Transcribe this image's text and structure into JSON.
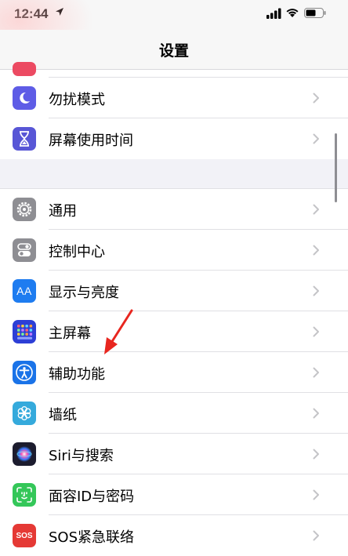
{
  "status_bar": {
    "time": "12:44"
  },
  "nav": {
    "title": "设置"
  },
  "group1": [
    {
      "label": "勿扰模式",
      "icon": "moon-icon",
      "color": "#5e5ce6"
    },
    {
      "label": "屏幕使用时间",
      "icon": "hourglass-icon",
      "color": "#5856d6"
    }
  ],
  "group2": [
    {
      "label": "通用",
      "icon": "gear-icon",
      "color": "#8e8e93"
    },
    {
      "label": "控制中心",
      "icon": "toggles-icon",
      "color": "#8e8e93"
    },
    {
      "label": "显示与亮度",
      "icon": "aa-icon",
      "color": "#1e7cf0",
      "icon_text": "AA"
    },
    {
      "label": "主屏幕",
      "icon": "home-grid-icon",
      "color": "#2d3fd6"
    },
    {
      "label": "辅助功能",
      "icon": "accessibility-icon",
      "color": "#1a73e8"
    },
    {
      "label": "墙纸",
      "icon": "flower-icon",
      "color": "#35aadc"
    },
    {
      "label": "Siri与搜索",
      "icon": "siri-icon",
      "color": "#1c1c2e"
    },
    {
      "label": "面容ID与密码",
      "icon": "face-id-icon",
      "color": "#34c759"
    },
    {
      "label": "SOS紧急联络",
      "icon": "sos-icon",
      "color": "#e53935",
      "icon_text": "SOS"
    }
  ],
  "colors": {
    "chevron": "#c4c4c7",
    "annotation_arrow": "#e8261f"
  }
}
